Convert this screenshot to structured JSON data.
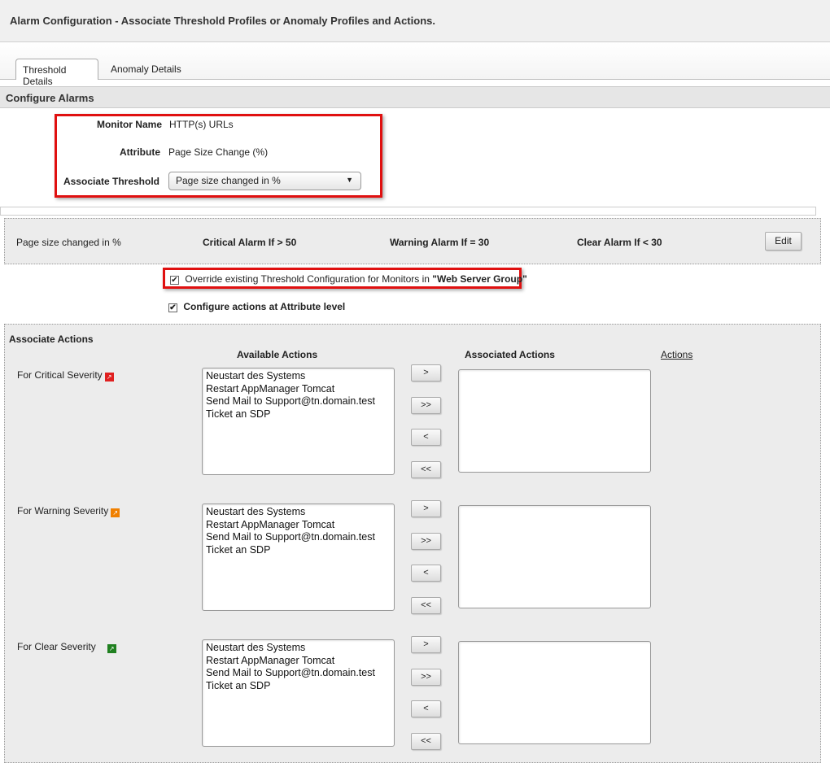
{
  "header": {
    "title": "Alarm Configuration - Associate Threshold Profiles or Anomaly Profiles and Actions."
  },
  "tabs": [
    {
      "label": "Threshold Details",
      "active": true
    },
    {
      "label": "Anomaly Details",
      "active": false
    }
  ],
  "section_title": "Configure Alarms",
  "form": {
    "monitor_name_label": "Monitor Name",
    "monitor_name": "HTTP(s) URLs",
    "attribute_label": "Attribute",
    "attribute": "Page Size Change (%)",
    "threshold_label": "Associate Threshold",
    "threshold_value": "Page size changed in %"
  },
  "threshold": {
    "name": "Page size changed in %",
    "critical": "Critical Alarm If > 50",
    "warning": "Warning Alarm If = 30",
    "clear": "Clear Alarm If < 30",
    "edit_label": "Edit"
  },
  "override": {
    "checked": true,
    "label": "Override existing Threshold Configuration for Monitors in ",
    "group": "\"Web Server Group\""
  },
  "attr_level": {
    "checked": true,
    "label": "Configure actions at Attribute level"
  },
  "actions": {
    "title": "Associate Actions",
    "available_header": "Available Actions",
    "associated_header": "Associated Actions",
    "actions_link": "Actions",
    "buttons": [
      ">",
      ">>",
      "<",
      "<<"
    ],
    "severities": [
      {
        "label": "For Critical Severity",
        "color": "#e02020",
        "available": [
          "Neustart des Systems",
          "Restart AppManager Tomcat",
          "Send Mail to Support@tn.domain.test",
          "Ticket an SDP"
        ],
        "associated": []
      },
      {
        "label": "For Warning Severity",
        "color": "#f08000",
        "available": [
          "Neustart des Systems",
          "Restart AppManager Tomcat",
          "Send Mail to Support@tn.domain.test",
          "Ticket an SDP"
        ],
        "associated": []
      },
      {
        "label": "For Clear Severity",
        "color": "#208020",
        "available": [
          "Neustart des Systems",
          "Restart AppManager Tomcat",
          "Send Mail to Support@tn.domain.test",
          "Ticket an SDP"
        ],
        "associated": []
      }
    ]
  }
}
